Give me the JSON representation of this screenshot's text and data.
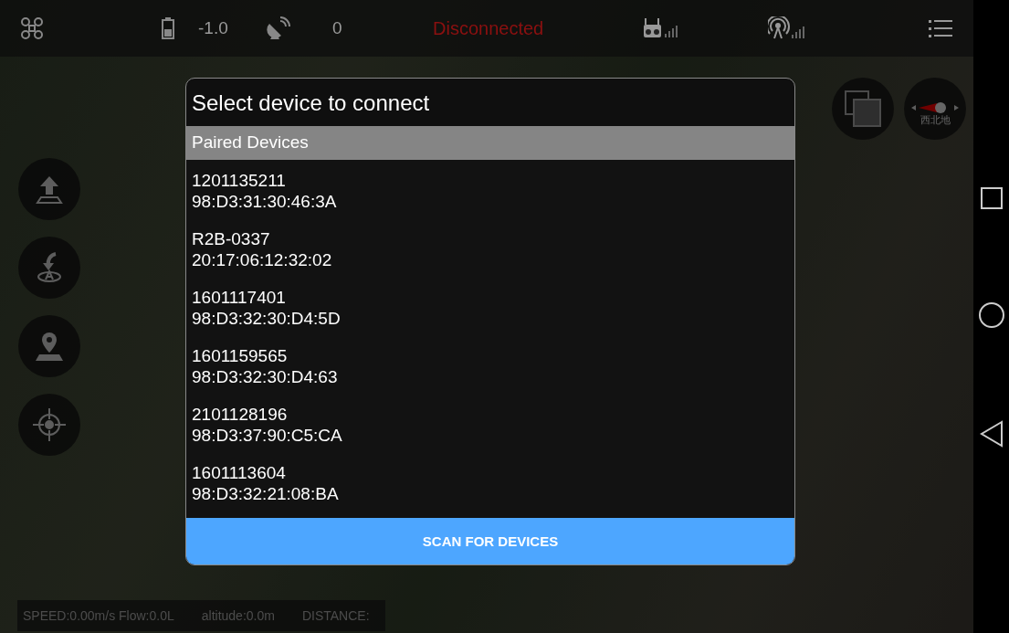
{
  "top_bar": {
    "battery_reading": "-1.0",
    "satellite_count": "0",
    "connection_status": "Disconnected"
  },
  "map_controls": {
    "compass_label": "西北地"
  },
  "dialog": {
    "title": "Select device to connect",
    "section_header": "Paired Devices",
    "devices": [
      {
        "name": "1201135211",
        "address": "98:D3:31:30:46:3A"
      },
      {
        "name": "R2B-0337",
        "address": "20:17:06:12:32:02"
      },
      {
        "name": "1601117401",
        "address": "98:D3:32:30:D4:5D"
      },
      {
        "name": "1601159565",
        "address": "98:D3:32:30:D4:63"
      },
      {
        "name": "2101128196",
        "address": "98:D3:37:90:C5:CA"
      },
      {
        "name": "1601113604",
        "address": "98:D3:32:21:08:BA"
      }
    ],
    "scan_button": "SCAN FOR DEVICES"
  },
  "status_bar": {
    "speed": "SPEED:0.00m/s Flow:0.0L",
    "altitude": "altitude:0.0m",
    "distance": "DISTANCE:"
  }
}
